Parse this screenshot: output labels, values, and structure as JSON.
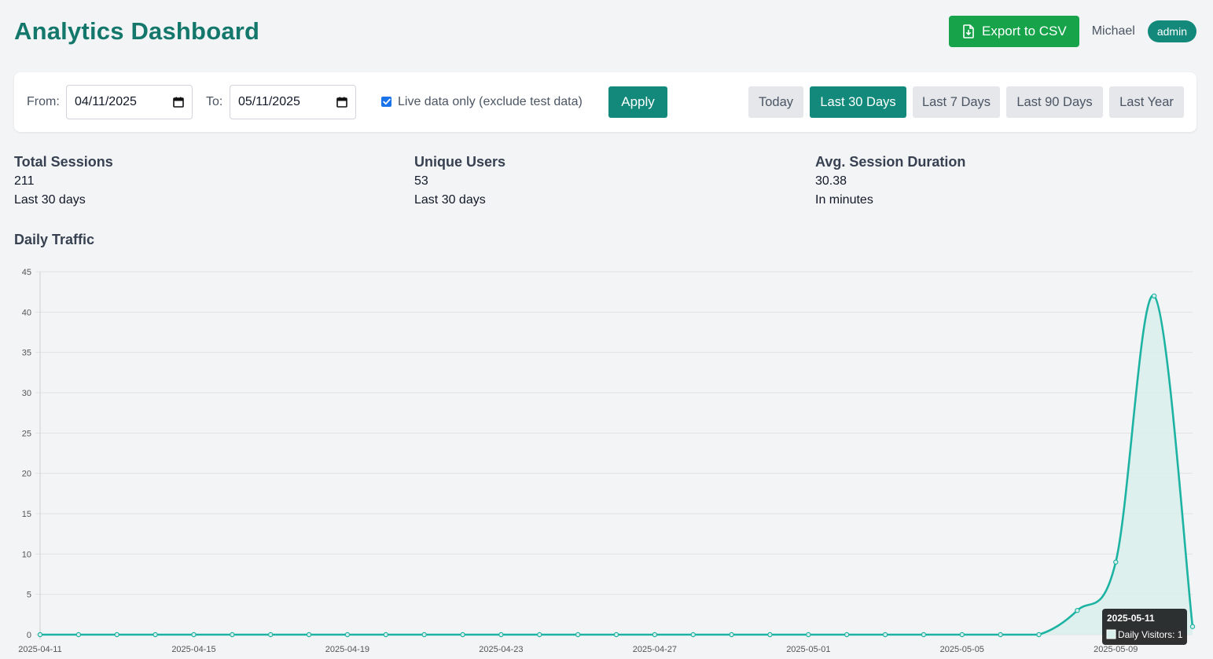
{
  "header": {
    "title": "Analytics Dashboard",
    "export_label": "Export to CSV",
    "username": "Michael",
    "role": "admin"
  },
  "filters": {
    "from_label": "From:",
    "from_value": "04/11/2025",
    "to_label": "To:",
    "to_value": "05/11/2025",
    "live_only_label": "Live data only (exclude test data)",
    "live_only_checked": true,
    "apply_label": "Apply",
    "ranges": [
      "Today",
      "Last 30 Days",
      "Last 7 Days",
      "Last 90 Days",
      "Last Year"
    ],
    "active_range": "Last 30 Days"
  },
  "stats": [
    {
      "title": "Total Sessions",
      "value": "211",
      "sub": "Last 30 days"
    },
    {
      "title": "Unique Users",
      "value": "53",
      "sub": "Last 30 days"
    },
    {
      "title": "Avg. Session Duration",
      "value": "30.38",
      "sub": "In minutes"
    }
  ],
  "colors": {
    "brand": "#13786b",
    "accent": "#13897b",
    "export": "#16a34a",
    "line": "#1db3a2",
    "fill": "#d9efec"
  },
  "chart_title": "Daily Traffic",
  "chart_data": {
    "type": "line",
    "x": [
      "2025-04-11",
      "2025-04-12",
      "2025-04-13",
      "2025-04-14",
      "2025-04-15",
      "2025-04-16",
      "2025-04-17",
      "2025-04-18",
      "2025-04-19",
      "2025-04-20",
      "2025-04-21",
      "2025-04-22",
      "2025-04-23",
      "2025-04-24",
      "2025-04-25",
      "2025-04-26",
      "2025-04-27",
      "2025-04-28",
      "2025-04-29",
      "2025-04-30",
      "2025-05-01",
      "2025-05-02",
      "2025-05-03",
      "2025-05-04",
      "2025-05-05",
      "2025-05-06",
      "2025-05-07",
      "2025-05-08",
      "2025-05-09",
      "2025-05-10",
      "2025-05-11"
    ],
    "x_tick_labels": [
      "2025-04-11",
      "2025-04-15",
      "2025-04-19",
      "2025-04-23",
      "2025-04-27",
      "2025-05-01",
      "2025-05-05",
      "2025-05-09"
    ],
    "series": [
      {
        "name": "Daily Visitors",
        "values": [
          0,
          0,
          0,
          0,
          0,
          0,
          0,
          0,
          0,
          0,
          0,
          0,
          0,
          0,
          0,
          0,
          0,
          0,
          0,
          0,
          0,
          0,
          0,
          0,
          0,
          0,
          0,
          3,
          9,
          42,
          1
        ]
      }
    ],
    "ylim": [
      0,
      45
    ],
    "y_ticks": [
      0,
      5,
      10,
      15,
      20,
      25,
      30,
      35,
      40,
      45
    ],
    "grid": true,
    "fill": true,
    "tooltip": {
      "title": "2025-05-11",
      "label": "Daily Visitors: 1"
    }
  }
}
